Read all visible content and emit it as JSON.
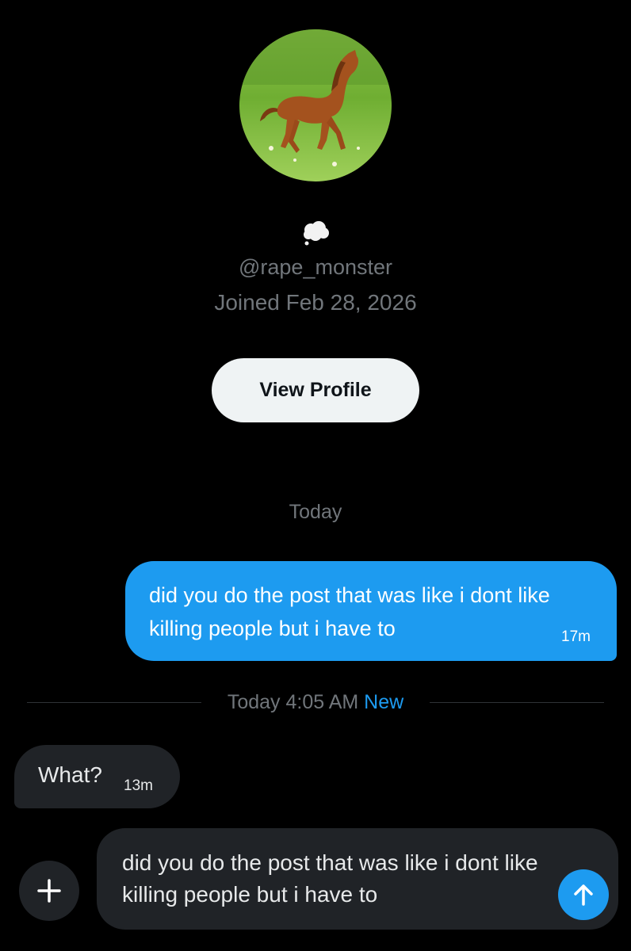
{
  "profile": {
    "avatar_icon": "horse-avatar",
    "status_icon": "thought-balloon-icon",
    "handle": "@rape_monster",
    "joined": "Joined Feb 28, 2026",
    "view_profile_label": "View Profile"
  },
  "conversation": {
    "day_label": "Today",
    "messages": [
      {
        "direction": "sent",
        "text": "did you do the post that was like i dont like killing people but i have to",
        "time": "17m"
      },
      {
        "direction": "received",
        "text": "What?",
        "time": "13m"
      }
    ],
    "divider": {
      "text": "Today 4:05 AM",
      "badge": "New"
    }
  },
  "composer": {
    "text": "did you do the post that was like i dont like killing people but i have to",
    "add_icon": "plus-icon",
    "send_icon": "arrow-up-icon"
  },
  "colors": {
    "accent": "#1d9bf0",
    "background": "#000000",
    "bubble_received": "#202327",
    "secondary_text": "#71767b"
  }
}
